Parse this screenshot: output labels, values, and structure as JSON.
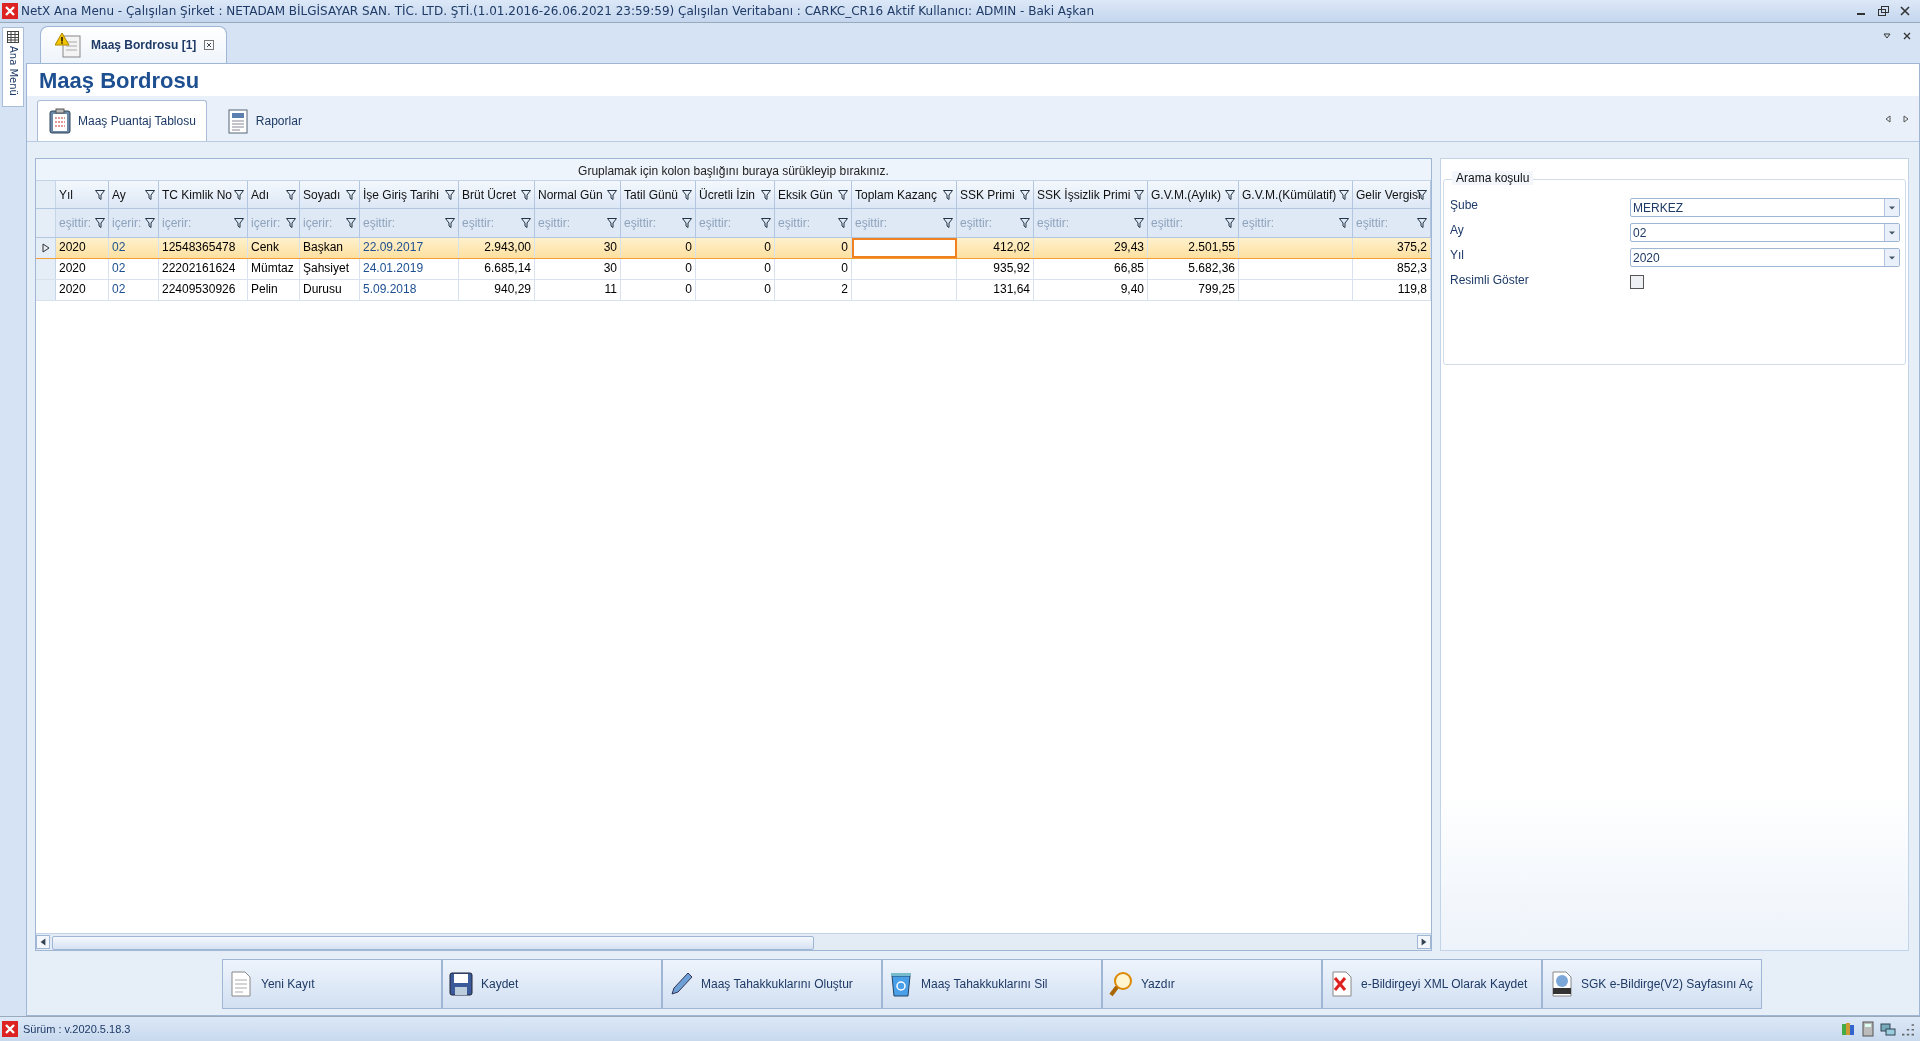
{
  "window": {
    "title": "NetX Ana Menu - Çalışılan Şirket : NETADAM BİLGİSAYAR SAN. TİC. LTD. ŞTİ.(1.01.2016-26.06.2021 23:59:59) Çalışılan Veritabanı : CARKC_CR16  Aktif Kullanıcı: ADMIN - Baki Aşkan"
  },
  "side_strip": {
    "label": "Ana Menü"
  },
  "doc_tab": {
    "label": "Maaş Bordrosu [1]"
  },
  "page_title": "Maaş Bordrosu",
  "tabs": [
    {
      "label": "Maaş Puantaj Tablosu",
      "selected": true
    },
    {
      "label": "Raporlar",
      "selected": false
    }
  ],
  "grid": {
    "group_hint": "Gruplamak için kolon başlığını buraya sürükleyip bırakınız.",
    "columns": [
      {
        "title": "Yıl",
        "filter": "eşittir:",
        "kind": "text"
      },
      {
        "title": "Ay",
        "filter": "içerir:",
        "kind": "code"
      },
      {
        "title": "TC Kimlik No",
        "filter": "içerir:",
        "kind": "text"
      },
      {
        "title": "Adı",
        "filter": "içerir:",
        "kind": "text"
      },
      {
        "title": "Soyadı",
        "filter": "içerir:",
        "kind": "text"
      },
      {
        "title": "İşe Giriş Tarihi",
        "filter": "eşittir:",
        "kind": "code"
      },
      {
        "title": "Brüt Ücret",
        "filter": "eşittir:",
        "kind": "number"
      },
      {
        "title": "Normal Gün",
        "filter": "eşittir:",
        "kind": "number"
      },
      {
        "title": "Tatil Günü",
        "filter": "eşittir:",
        "kind": "number"
      },
      {
        "title": "Ücretli İzin",
        "filter": "eşittir:",
        "kind": "number"
      },
      {
        "title": "Eksik Gün",
        "filter": "eşittir:",
        "kind": "number"
      },
      {
        "title": "Toplam Kazanç",
        "filter": "eşittir:",
        "kind": "number",
        "focused": true
      },
      {
        "title": "SSK Primi",
        "filter": "eşittir:",
        "kind": "number"
      },
      {
        "title": "SSK İşsizlik Primi",
        "filter": "eşittir:",
        "kind": "number"
      },
      {
        "title": "G.V.M.(Aylık)",
        "filter": "eşittir:",
        "kind": "number"
      },
      {
        "title": "G.V.M.(Kümülatif)",
        "filter": "eşittir:",
        "kind": "number"
      },
      {
        "title": "Gelir Vergisi",
        "filter": "eşittir:",
        "kind": "number"
      }
    ],
    "rows": [
      {
        "selected": true,
        "cells": [
          "2020",
          "02",
          "12548365478",
          "Cenk",
          "Başkan",
          "22.09.2017",
          "2.943,00",
          "30",
          "0",
          "0",
          "0",
          null,
          "412,02",
          "29,43",
          "2.501,55",
          null,
          "375,2"
        ]
      },
      {
        "selected": false,
        "cells": [
          "2020",
          "02",
          "22202161624",
          "Mümtaz",
          "Şahsiyet",
          "24.01.2019",
          "6.685,14",
          "30",
          "0",
          "0",
          "0",
          null,
          "935,92",
          "66,85",
          "5.682,36",
          null,
          "852,3"
        ]
      },
      {
        "selected": false,
        "cells": [
          "2020",
          "02",
          "22409530926",
          "Pelin",
          "Durusu",
          "5.09.2018",
          "940,29",
          "11",
          "0",
          "0",
          "2",
          null,
          "131,64",
          "9,40",
          "799,25",
          null,
          "119,8"
        ]
      }
    ]
  },
  "search": {
    "title": "Arama koşulu",
    "fields": [
      {
        "label": "Şube",
        "value": "MERKEZ",
        "kind": "combo"
      },
      {
        "label": "Ay",
        "value": "02",
        "kind": "combo"
      },
      {
        "label": "Yıl",
        "value": "2020",
        "kind": "combo"
      },
      {
        "label": "Resimli Göster",
        "checked": false,
        "kind": "checkbox"
      }
    ]
  },
  "buttons": [
    {
      "label": "Yeni Kayıt",
      "kind": "new"
    },
    {
      "label": "Kaydet",
      "kind": "save"
    },
    {
      "label": "Maaş Tahakkuklarını Oluştur",
      "kind": "create"
    },
    {
      "label": "Maaş Tahakkuklarını Sil",
      "kind": "delete"
    },
    {
      "label": "Yazdır",
      "kind": "print"
    },
    {
      "label": "e-Bildirgeyi XML Olarak Kaydet",
      "kind": "xml"
    },
    {
      "label": "SGK e-Bildirge(V2) Sayfasını Aç",
      "kind": "html"
    }
  ],
  "status_bar": {
    "version": "Sürüm : v.2020.5.18.3"
  }
}
